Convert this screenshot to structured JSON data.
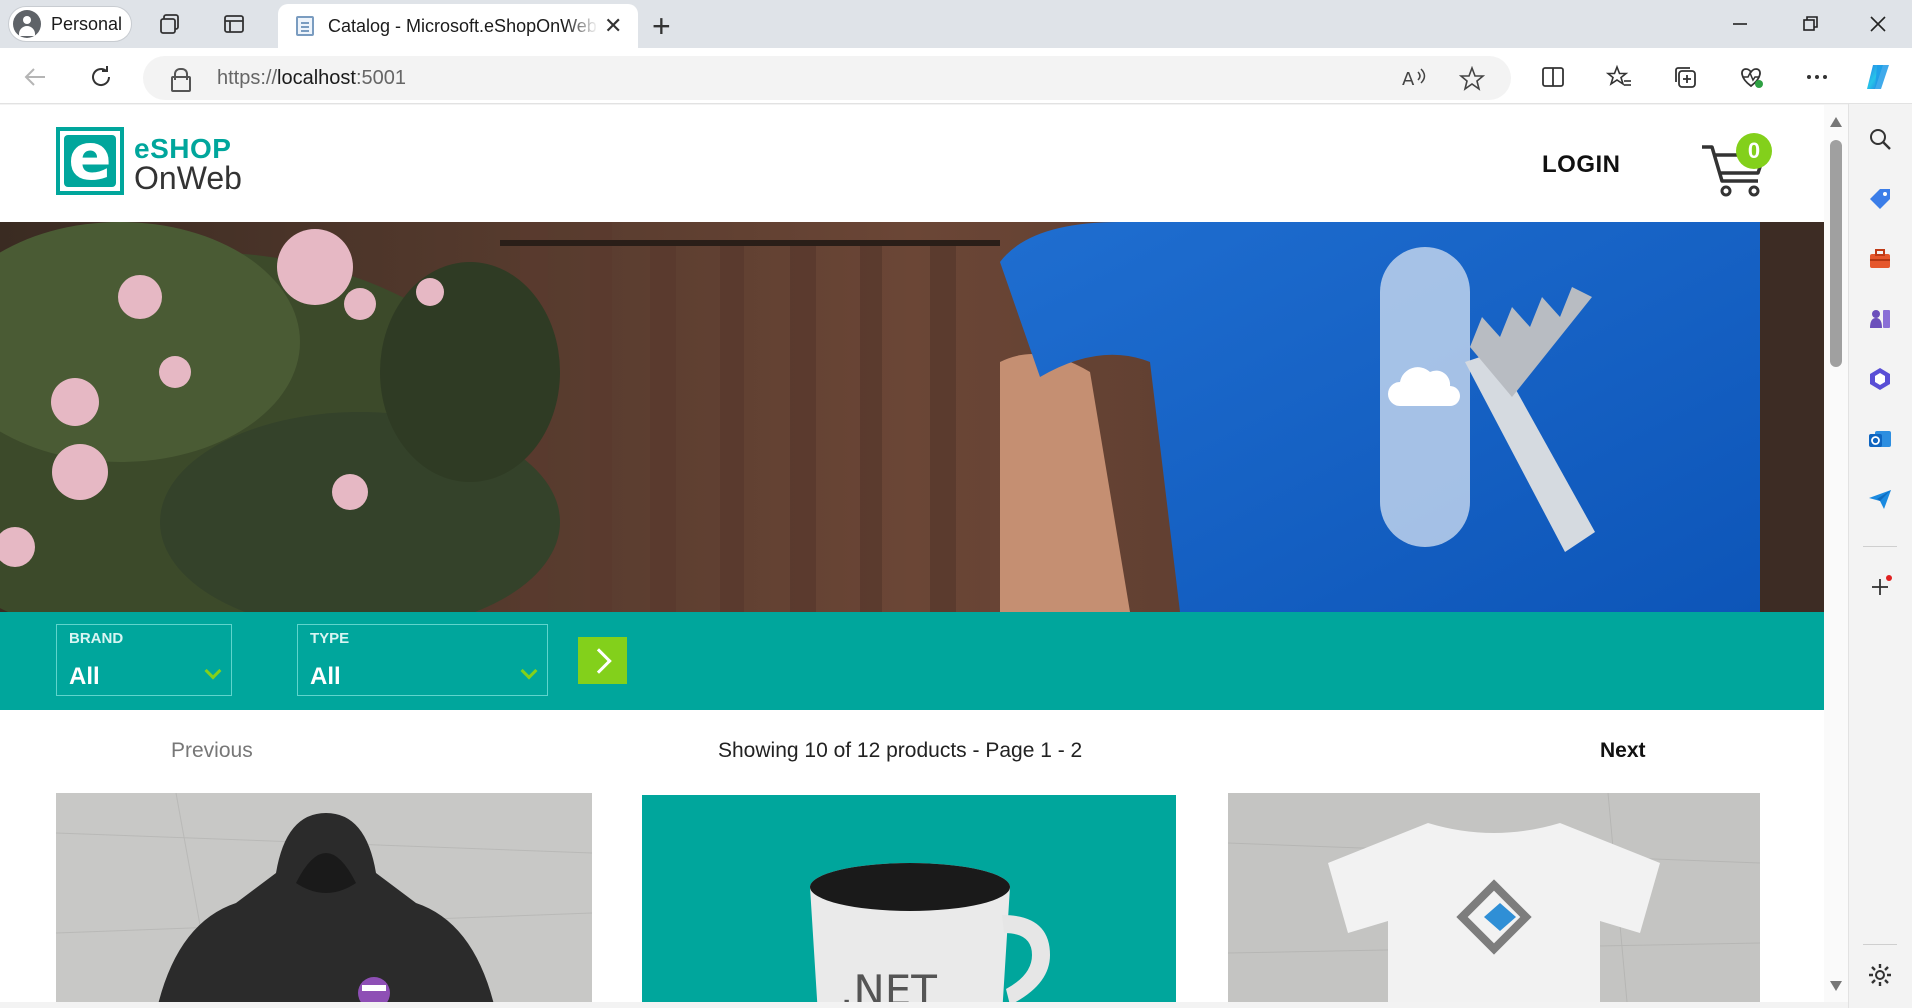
{
  "browser": {
    "profile_label": "Personal",
    "tab_title": "Catalog - Microsoft.eShopOnWeb",
    "url_scheme": "https://",
    "url_host": "localhost",
    "url_port": ":5001",
    "icons": {
      "workspaces": "workspaces-icon",
      "tab_actions": "tab-actions-icon",
      "back": "back-arrow-icon",
      "refresh": "refresh-icon",
      "read_aloud": "read-aloud-icon",
      "favorite": "star-icon",
      "split_screen": "split-screen-icon",
      "favorites": "favorites-icon",
      "collections": "collections-icon",
      "performance": "heartbeat-icon",
      "more": "more-icon",
      "copilot": "copilot-icon"
    }
  },
  "sidebar": {
    "items": [
      "search-icon",
      "tag-icon",
      "toolbox-icon",
      "games-icon",
      "office-icon",
      "outlook-icon",
      "send-icon"
    ]
  },
  "site": {
    "logo_top": "eSHOP",
    "logo_bottom": "OnWeb",
    "logo_mark": "e",
    "login_label": "LOGIN",
    "cart_count": "0",
    "brand_color": "#00a69c",
    "accent_color": "#83d01b"
  },
  "filters": {
    "brand_label": "BRAND",
    "brand_value": "All",
    "type_label": "TYPE",
    "type_value": "All"
  },
  "pager": {
    "previous": "Previous",
    "info": "Showing 10 of 12 products - Page 1 - 2",
    "next": "Next"
  },
  "products": [
    {
      "image": "hoodie-product-image",
      "mug_text": ""
    },
    {
      "image": "mug-product-image",
      "mug_text": ".NET"
    },
    {
      "image": "tshirt-product-image",
      "mug_text": ""
    }
  ]
}
